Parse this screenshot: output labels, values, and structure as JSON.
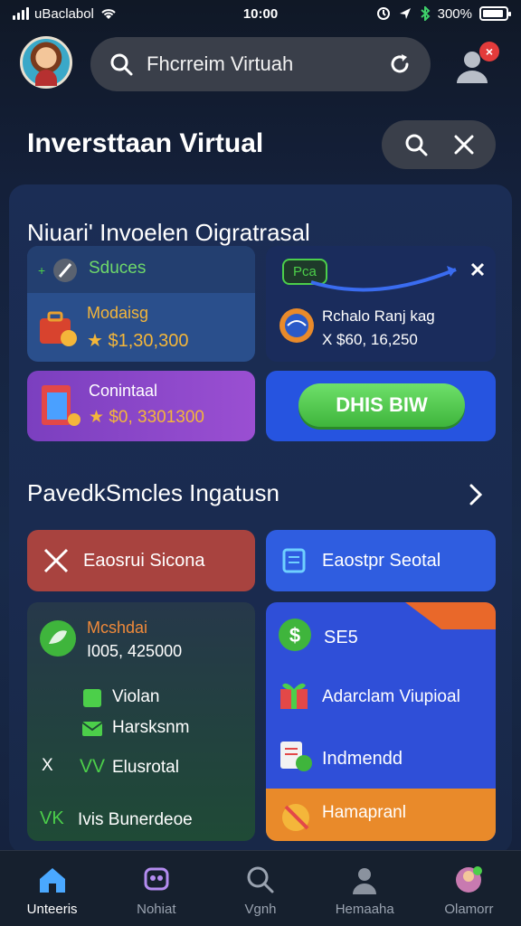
{
  "status_bar": {
    "carrier": "uBaclabol",
    "time": "10:00",
    "battery": "300%",
    "battery_level": 0.9
  },
  "top_bar": {
    "search_placeholder": "Fhcrreim Virtuah",
    "notification_count": "×"
  },
  "page": {
    "title": "Inversttaаn Virtual"
  },
  "section1": {
    "title": "Niuari' Invoelen Oigratrasal",
    "stats_tile": {
      "tag": "Sduces",
      "label": "Modaisg",
      "value": "$1,30,300"
    },
    "chart_tile": {
      "badge": "Pca",
      "label": "Rchalo Ranj kag",
      "value": "X $60, 16,250"
    },
    "purple_tile": {
      "label": "Conintaal",
      "value": "$0, 3301300"
    },
    "blue_tile": {
      "button_label": "DHIS BIW"
    }
  },
  "section2": {
    "title": "PavedkSmcles Ingatusn",
    "buttons": [
      {
        "label": "Eaosrui Sicona",
        "color": "#a8433f"
      },
      {
        "label": "Eaostpr Seotal",
        "color": "#2f5de0"
      }
    ],
    "left_card": {
      "title": "Mcshdai",
      "amount": "I005, 425000",
      "items": [
        {
          "label": "Violan",
          "icon": "cube-icon"
        },
        {
          "label": "Harsksnm",
          "icon": "mail-icon"
        }
      ],
      "rows": [
        {
          "prefix": "X",
          "mid": "VV",
          "label": "Elusrotal"
        },
        {
          "prefix": "VK",
          "label": "Ivis Bunerdeoe"
        }
      ]
    },
    "right_card": {
      "items": [
        {
          "label": "SE5",
          "icon": "dollar-icon"
        },
        {
          "label": "Adarclam Viupioal",
          "icon": "gift-icon"
        },
        {
          "label": "Indmendd",
          "icon": "receipt-icon"
        },
        {
          "label": "Hamapranl",
          "icon": "money-bag-icon"
        }
      ]
    }
  },
  "bottom_nav": {
    "items": [
      {
        "label": "Unteeris",
        "icon": "home-icon",
        "active": true
      },
      {
        "label": "Nohiat",
        "icon": "robot-icon",
        "active": false
      },
      {
        "label": "Vgnh",
        "icon": "search-icon",
        "active": false
      },
      {
        "label": "Hemaaha",
        "icon": "person-icon",
        "active": false
      },
      {
        "label": "Olamorr",
        "icon": "avatar-icon",
        "active": false
      }
    ]
  },
  "colors": {
    "accent_green": "#4ccf4a",
    "accent_blue": "#2654e0",
    "accent_purple": "#8a47c9",
    "accent_red": "#a8433f",
    "accent_orange": "#e98a2a"
  }
}
